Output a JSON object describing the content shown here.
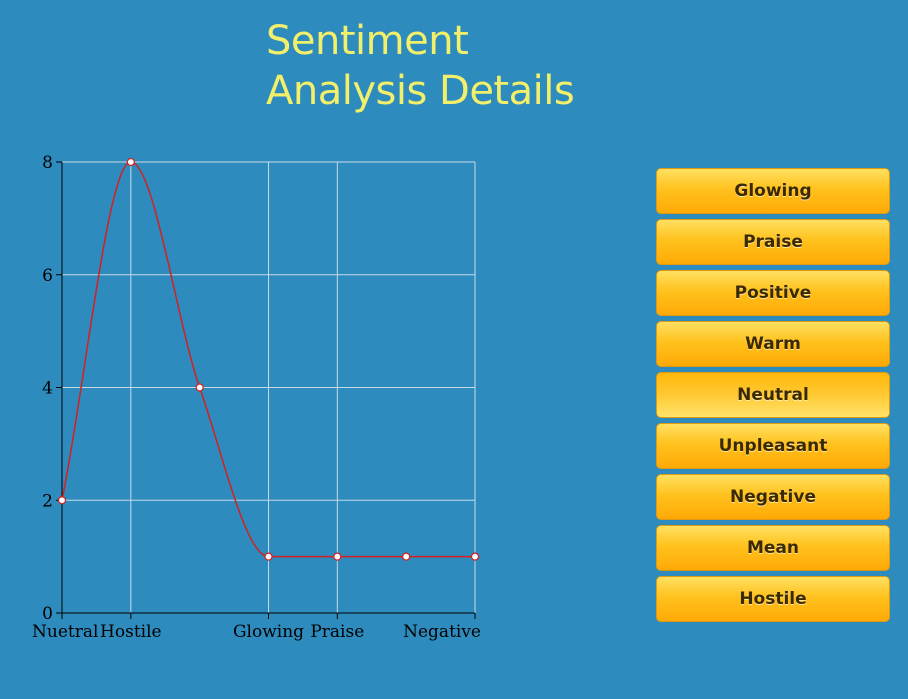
{
  "title": {
    "line1": "Sentiment",
    "line2": "Analysis Details"
  },
  "colors": {
    "background": "#2e8bbd",
    "title": "#f2ef6b",
    "line": "#d42020",
    "grid": "#c9d9e8",
    "button": "#ffc21e"
  },
  "chart_data": {
    "type": "line",
    "curve": "smooth",
    "x": [
      0,
      1,
      2,
      3,
      4,
      5,
      6
    ],
    "y": [
      2,
      8,
      4,
      1,
      1,
      1,
      1
    ],
    "xlim": [
      0,
      6
    ],
    "ylim": [
      0,
      8
    ],
    "x_tick_labels": [
      {
        "x": 0,
        "label": "Nuetral"
      },
      {
        "x": 1,
        "label": "Hostile"
      },
      {
        "x": 3,
        "label": "Glowing"
      },
      {
        "x": 4,
        "label": "Praise"
      },
      {
        "x": 6,
        "label": "Negative"
      }
    ],
    "y_ticks": [
      0,
      2,
      4,
      6,
      8
    ],
    "x_grid": [
      1,
      3,
      4,
      6
    ],
    "grid": true
  },
  "buttons": [
    {
      "label": "Glowing",
      "active": false
    },
    {
      "label": "Praise",
      "active": false
    },
    {
      "label": "Positive",
      "active": false
    },
    {
      "label": "Warm",
      "active": false
    },
    {
      "label": "Neutral",
      "active": true
    },
    {
      "label": "Unpleasant",
      "active": false
    },
    {
      "label": "Negative",
      "active": false
    },
    {
      "label": "Mean",
      "active": false
    },
    {
      "label": "Hostile",
      "active": false
    }
  ]
}
